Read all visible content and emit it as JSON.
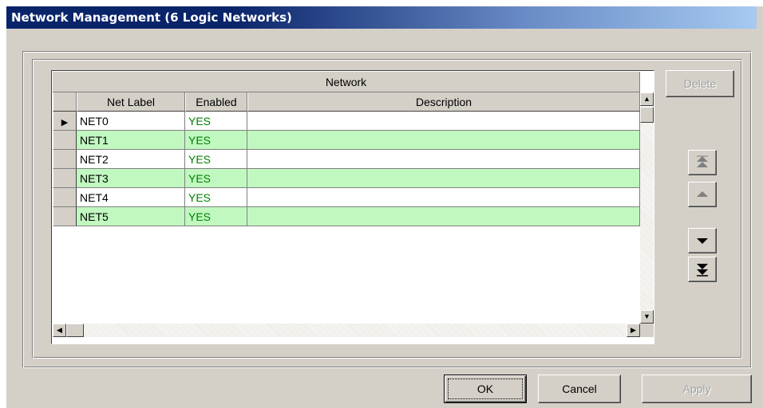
{
  "window": {
    "title": "Network Management (6 Logic Networks)"
  },
  "grid": {
    "group_header": "Network",
    "columns": [
      "Net Label",
      "Enabled",
      "Description"
    ],
    "rows": [
      {
        "label": "NET0",
        "enabled": "YES",
        "description": "",
        "selected": true
      },
      {
        "label": "NET1",
        "enabled": "YES",
        "description": ""
      },
      {
        "label": "NET2",
        "enabled": "YES",
        "description": ""
      },
      {
        "label": "NET3",
        "enabled": "YES",
        "description": ""
      },
      {
        "label": "NET4",
        "enabled": "YES",
        "description": ""
      },
      {
        "label": "NET5",
        "enabled": "YES",
        "description": ""
      }
    ],
    "row_colors": [
      "#ffffff",
      "#c0f8c0"
    ]
  },
  "side": {
    "delete_label": "Delete",
    "move_top_icon": "double-up-arrow",
    "move_up_icon": "up-arrow",
    "move_down_icon": "down-arrow",
    "move_bottom_icon": "double-down-arrow"
  },
  "footer": {
    "ok_label": "OK",
    "cancel_label": "Cancel",
    "apply_label": "Apply"
  },
  "colors": {
    "title_bar": "#0a246a",
    "enabled_text": "#008000",
    "row_alt": "#c0f8c0"
  }
}
